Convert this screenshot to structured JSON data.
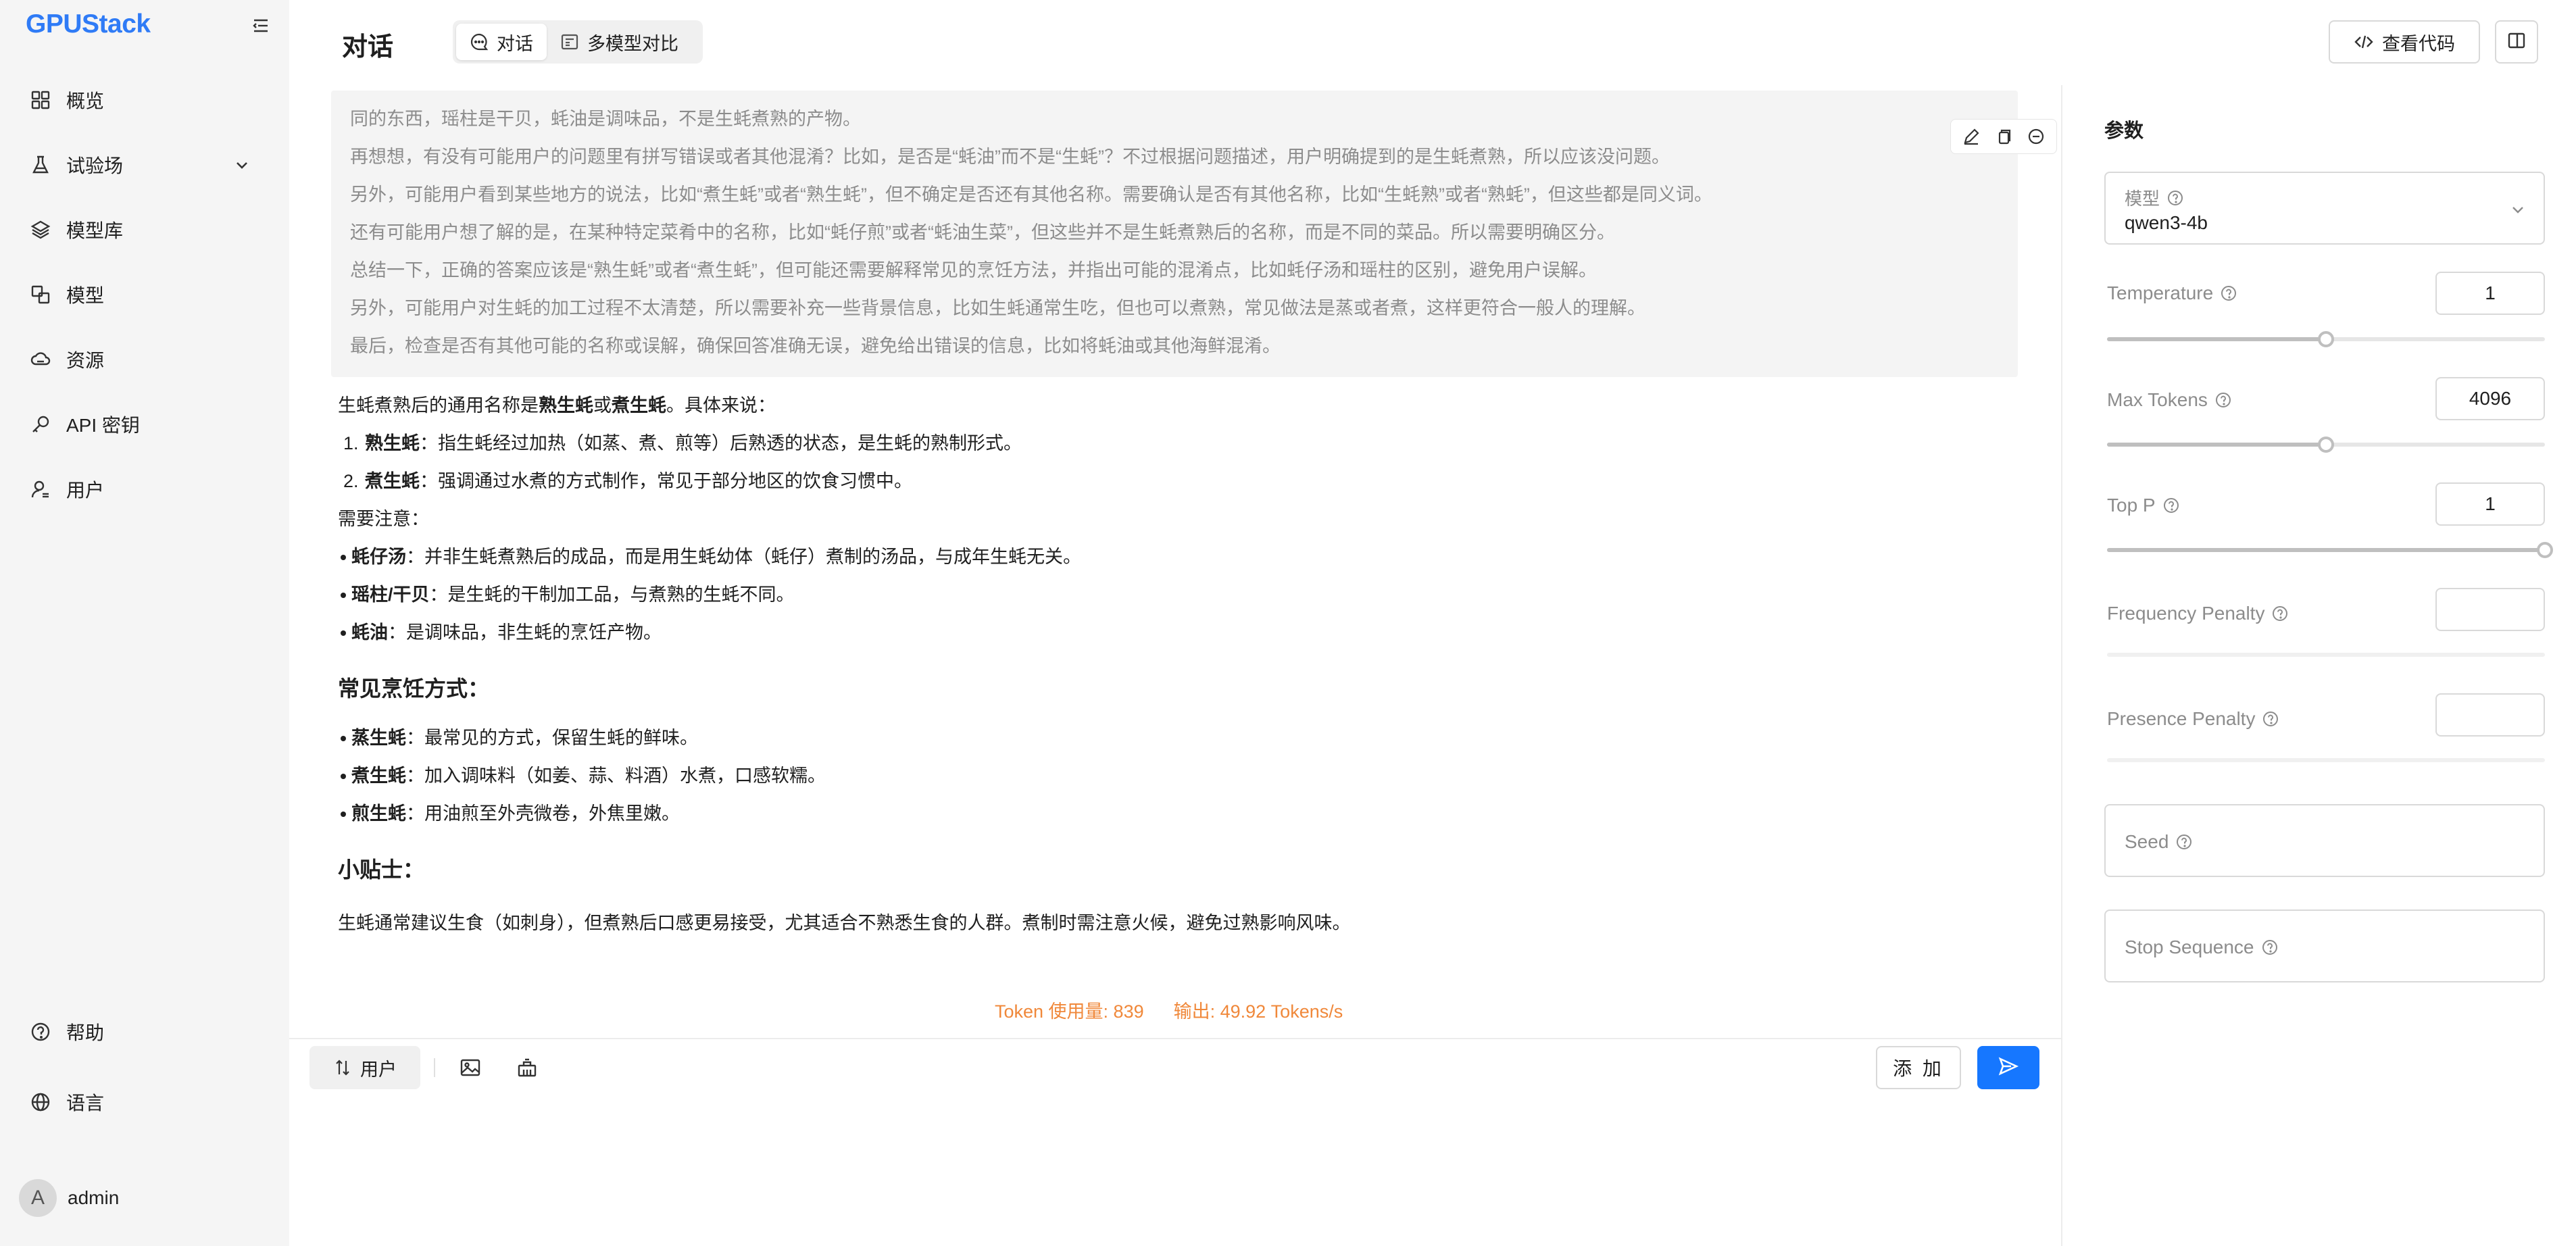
{
  "app": {
    "logo_letter": "G",
    "logo_rest": "PUStack"
  },
  "sidebar": {
    "items": [
      {
        "label": "概览",
        "icon": "grid-icon"
      },
      {
        "label": "试验场",
        "icon": "flask-icon"
      },
      {
        "label": "模型库",
        "icon": "layers-icon"
      },
      {
        "label": "模型",
        "icon": "model-icon"
      },
      {
        "label": "资源",
        "icon": "cloud-icon"
      },
      {
        "label": "API 密钥",
        "icon": "key-icon"
      },
      {
        "label": "用户",
        "icon": "user-icon"
      }
    ],
    "bottom": [
      {
        "label": "帮助",
        "icon": "help-icon"
      },
      {
        "label": "语言",
        "icon": "globe-icon"
      }
    ],
    "user": {
      "avatar": "A",
      "name": "admin"
    }
  },
  "header": {
    "title": "对话",
    "tabs": [
      {
        "label": "对话",
        "active": true
      },
      {
        "label": "多模型对比",
        "active": false
      }
    ],
    "view_code": "查看代码"
  },
  "chat": {
    "thinking": [
      "同的东西，瑶柱是干贝，蚝油是调味品，不是生蚝煮熟的产物。",
      "再想想，有没有可能用户的问题里有拼写错误或者其他混淆？比如，是否是“蚝油”而不是“生蚝”？不过根据问题描述，用户明确提到的是生蚝煮熟，所以应该没问题。",
      "另外，可能用户看到某些地方的说法，比如“煮生蚝”或者“熟生蚝”，但不确定是否还有其他名称。需要确认是否有其他名称，比如“生蚝熟”或者“熟蚝”，但这些都是同义词。",
      "还有可能用户想了解的是，在某种特定菜肴中的名称，比如“蚝仔煎”或者“蚝油生菜”，但这些并不是生蚝煮熟后的名称，而是不同的菜品。所以需要明确区分。",
      "总结一下，正确的答案应该是“熟生蚝”或者“煮生蚝”，但可能还需要解释常见的烹饪方法，并指出可能的混淆点，比如蚝仔汤和瑶柱的区别，避免用户误解。",
      "另外，可能用户对生蚝的加工过程不太清楚，所以需要补充一些背景信息，比如生蚝通常生吃，但也可以煮熟，常见做法是蒸或者煮，这样更符合一般人的理解。",
      "最后，检查是否有其他可能的名称或误解，确保回答准确无误，避免给出错误的信息，比如将蚝油或其他海鲜混淆。"
    ],
    "answer": {
      "intro_pre": "生蚝煮熟后的通用名称是",
      "intro_b1": "熟生蚝",
      "intro_mid": "或",
      "intro_b2": "煮生蚝",
      "intro_post": "。具体来说：",
      "ol": [
        {
          "num": "1.",
          "bold": "熟生蚝",
          "text": "：指生蚝经过加热（如蒸、煮、煎等）后熟透的状态，是生蚝的熟制形式。"
        },
        {
          "num": "2.",
          "bold": "煮生蚝",
          "text": "：强调通过水煮的方式制作，常见于部分地区的饮食习惯中。"
        }
      ],
      "note_label": "需要注意：",
      "notes": [
        {
          "bold": "蚝仔汤",
          "text": "：并非生蚝煮熟后的成品，而是用生蚝幼体（蚝仔）煮制的汤品，与成年生蚝无关。"
        },
        {
          "bold": "瑶柱/干贝",
          "text": "：是生蚝的干制加工品，与煮熟的生蚝不同。"
        },
        {
          "bold": "蚝油",
          "text": "：是调味品，非生蚝的烹饪产物。"
        }
      ],
      "cooking_title": "常见烹饪方式：",
      "cooking": [
        {
          "bold": "蒸生蚝",
          "text": "：最常见的方式，保留生蚝的鲜味。"
        },
        {
          "bold": "煮生蚝",
          "text": "：加入调味料（如姜、蒜、料酒）水煮，口感软糯。"
        },
        {
          "bold": "煎生蚝",
          "text": "：用油煎至外壳微卷，外焦里嫩。"
        }
      ],
      "tips_title": "小贴士：",
      "tips": "生蚝通常建议生食（如刺身），但煮熟后口感更易接受，尤其适合不熟悉生食的人群。煮制时需注意火候，避免过熟影响风味。"
    },
    "token_usage": "Token 使用量: 839",
    "output_speed": "输出: 49.92 Tokens/s"
  },
  "input": {
    "role": "用户",
    "add": "添 加",
    "placeholder": ""
  },
  "params": {
    "title": "参数",
    "model_label": "模型",
    "model_value": "qwen3-4b",
    "temperature": {
      "label": "Temperature",
      "value": "1",
      "fraction": 0.5
    },
    "max_tokens": {
      "label": "Max Tokens",
      "value": "4096",
      "fraction": 0.5
    },
    "top_p": {
      "label": "Top P",
      "value": "1",
      "fraction": 1.0
    },
    "frequency_penalty": {
      "label": "Frequency Penalty",
      "value": ""
    },
    "presence_penalty": {
      "label": "Presence Penalty",
      "value": ""
    },
    "seed": {
      "label": "Seed"
    },
    "stop_sequence": {
      "label": "Stop Sequence"
    }
  },
  "colors": {
    "brand": "#2f7bf6",
    "primary": "#1677ff",
    "token_text": "#f0883a"
  }
}
